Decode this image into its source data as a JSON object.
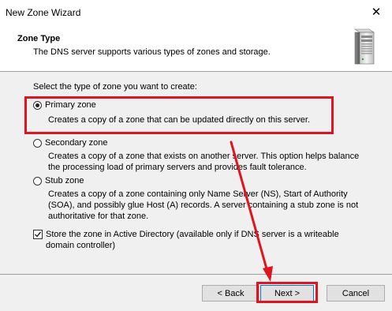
{
  "window": {
    "title": "New Zone Wizard",
    "close_symbol": "✕"
  },
  "header": {
    "title": "Zone Type",
    "subtitle": "The DNS server supports various types of zones and storage."
  },
  "body": {
    "prompt": "Select the type of zone you want to create:",
    "options": [
      {
        "label": "Primary zone",
        "description": "Creates a copy of a zone that can be updated directly on this server.",
        "selected": true
      },
      {
        "label": "Secondary zone",
        "description": "Creates a copy of a zone that exists on another server. This option helps balance the processing load of primary servers and provides fault tolerance.",
        "selected": false
      },
      {
        "label": "Stub zone",
        "description": "Creates a copy of a zone containing only Name Server (NS), Start of Authority (SOA), and possibly glue Host (A) records. A server containing a stub zone is not authoritative for that zone.",
        "selected": false
      }
    ],
    "ad_checkbox": {
      "label": "Store the zone in Active Directory (available only if DNS server is a writeable domain controller)",
      "checked": true
    }
  },
  "footer": {
    "back_label": "< Back",
    "next_label": "Next >",
    "cancel_label": "Cancel"
  },
  "annotation": {
    "color": "#e0141e"
  }
}
